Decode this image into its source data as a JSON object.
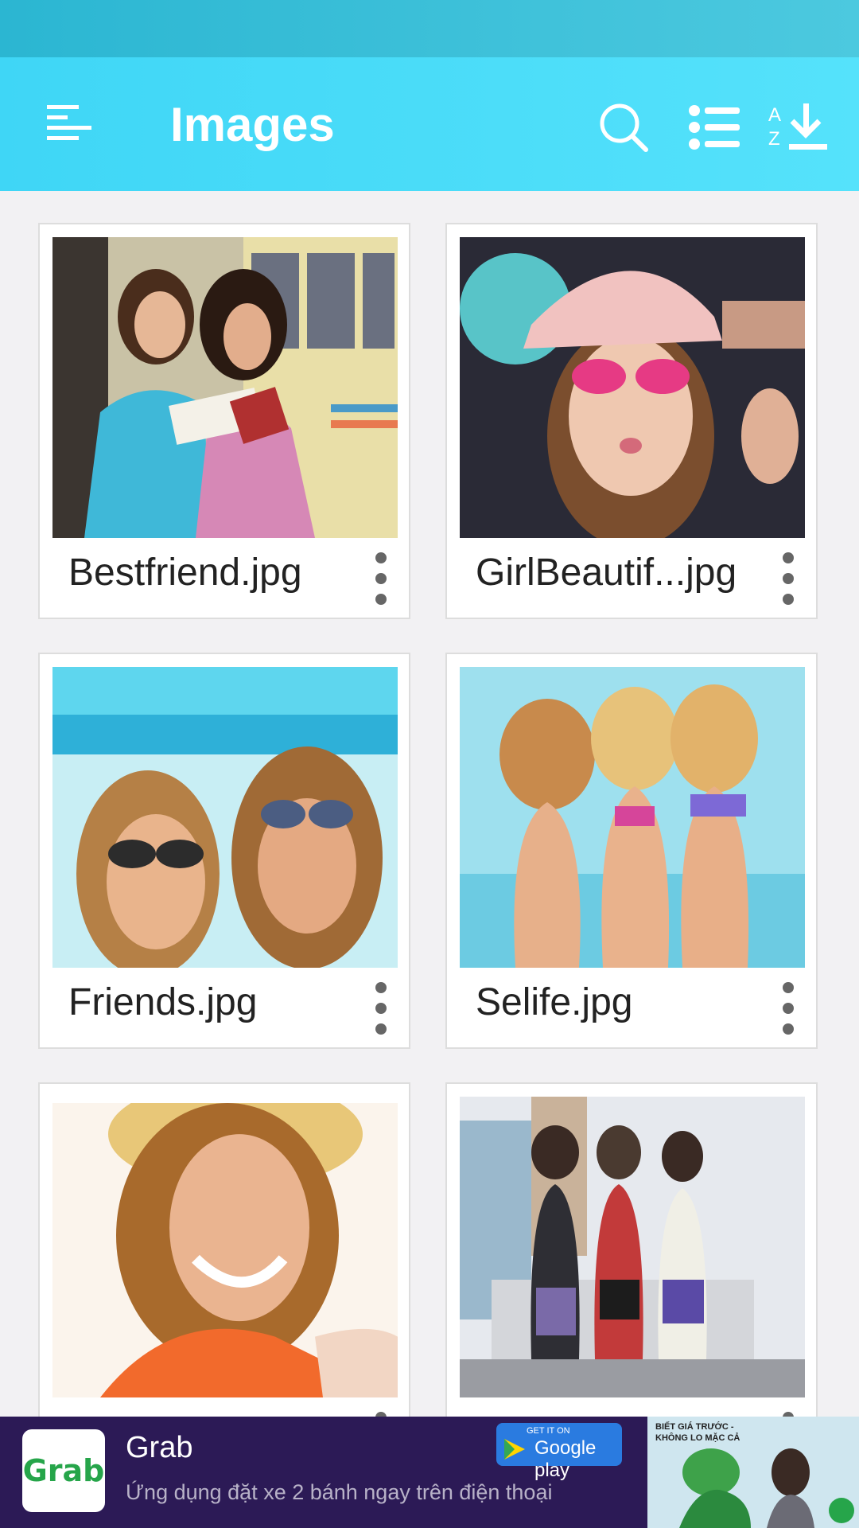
{
  "app_bar": {
    "title": "Images",
    "icons": [
      "menu-icon",
      "search-icon",
      "list-view-icon",
      "sort-az-icon"
    ],
    "sort_icon_letters": "AZ"
  },
  "files": [
    {
      "name": "Bestfriend.jpg"
    },
    {
      "name": "GirlBeautif...jpg"
    },
    {
      "name": "Friends.jpg"
    },
    {
      "name": "Selife.jpg"
    },
    {
      "name": ""
    },
    {
      "name": ""
    }
  ],
  "ad": {
    "brand": "Grab",
    "logo_text": "Grab",
    "description": "Ứng dụng đặt xe 2 bánh ngay trên điện thoại",
    "store_badge_top": "GET IT ON",
    "store_badge_main": "Google play",
    "promo_text": "BIẾT GIÁ TRƯỚC - KHÔNG LO MẶC CẢ"
  },
  "colors": {
    "app_bar": "#4ddcf8",
    "status_bar": "#33bcd6",
    "ad_background": "#2c1a56",
    "grab_green": "#26a54a"
  }
}
